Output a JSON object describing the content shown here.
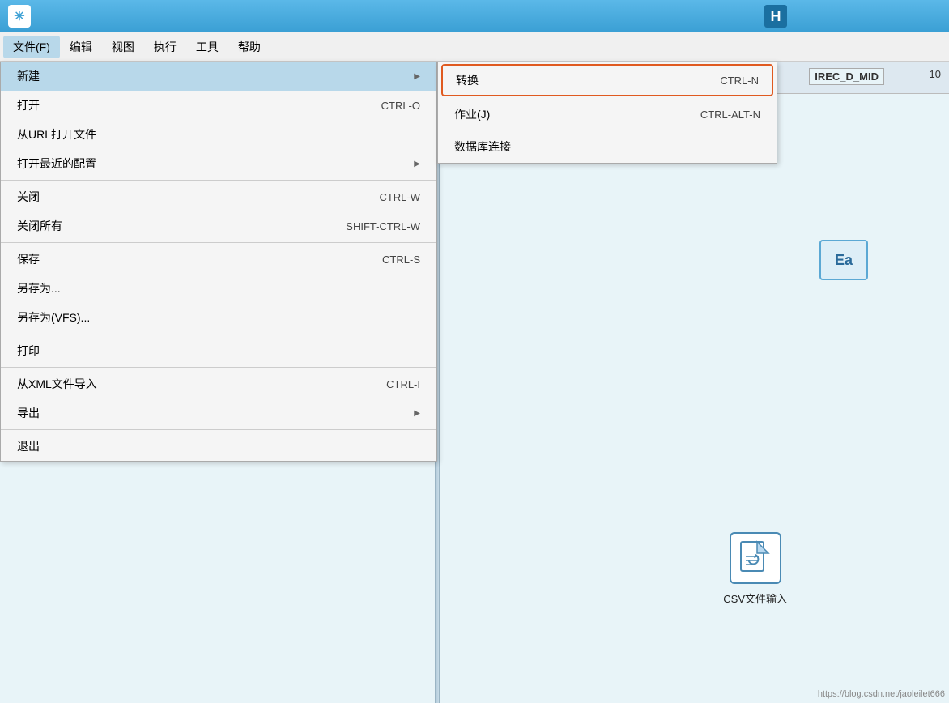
{
  "titleBar": {
    "icon": "✳",
    "plusLabel": "H"
  },
  "menuBar": {
    "items": [
      {
        "id": "file",
        "label": "文件(F)",
        "active": true
      },
      {
        "id": "edit",
        "label": "编辑",
        "active": false
      },
      {
        "id": "view",
        "label": "视图",
        "active": false
      },
      {
        "id": "execute",
        "label": "执行",
        "active": false
      },
      {
        "id": "tools",
        "label": "工具",
        "active": false
      },
      {
        "id": "help",
        "label": "帮助",
        "active": false
      }
    ]
  },
  "fileMenu": {
    "items": [
      {
        "id": "new",
        "label": "新建",
        "shortcut": "",
        "hasArrow": true,
        "active": true,
        "separator": false
      },
      {
        "id": "open",
        "label": "打开",
        "shortcut": "CTRL-O",
        "hasArrow": false,
        "active": false,
        "separator": false
      },
      {
        "id": "open-url",
        "label": "从URL打开文件",
        "shortcut": "",
        "hasArrow": false,
        "active": false,
        "separator": false
      },
      {
        "id": "open-recent",
        "label": "打开最近的配置",
        "shortcut": "",
        "hasArrow": true,
        "active": false,
        "separator": true
      },
      {
        "id": "close",
        "label": "关闭",
        "shortcut": "CTRL-W",
        "hasArrow": false,
        "active": false,
        "separator": false
      },
      {
        "id": "close-all",
        "label": "关闭所有",
        "shortcut": "SHIFT-CTRL-W",
        "hasArrow": false,
        "active": false,
        "separator": true
      },
      {
        "id": "save",
        "label": "保存",
        "shortcut": "CTRL-S",
        "hasArrow": false,
        "active": false,
        "separator": false
      },
      {
        "id": "save-as",
        "label": "另存为...",
        "shortcut": "",
        "hasArrow": false,
        "active": false,
        "separator": false
      },
      {
        "id": "save-vfs",
        "label": "另存为(VFS)...",
        "shortcut": "",
        "hasArrow": false,
        "active": false,
        "separator": true
      },
      {
        "id": "print",
        "label": "打印",
        "shortcut": "",
        "hasArrow": false,
        "active": false,
        "separator": true
      },
      {
        "id": "import-xml",
        "label": "从XML文件导入",
        "shortcut": "CTRL-I",
        "hasArrow": false,
        "active": false,
        "separator": false
      },
      {
        "id": "export",
        "label": "导出",
        "shortcut": "",
        "hasArrow": true,
        "active": false,
        "separator": true
      },
      {
        "id": "quit",
        "label": "退出",
        "shortcut": "",
        "hasArrow": false,
        "active": false,
        "separator": false
      }
    ]
  },
  "newSubmenu": {
    "items": [
      {
        "id": "transform",
        "label": "转换",
        "shortcut": "CTRL-N",
        "highlighted": true
      },
      {
        "id": "job",
        "label": "作业(J)",
        "shortcut": "CTRL-ALT-N",
        "highlighted": false
      },
      {
        "id": "db-connect",
        "label": "数据库连接",
        "shortcut": "",
        "highlighted": false
      }
    ]
  },
  "background": {
    "irecLabel": "IREC_D_MID",
    "eaText": "Ea",
    "numDisplay": "10",
    "csvIconLabel": "CSV文件输入"
  },
  "watermark": "https://blog.csdn.net/jaoleilet666"
}
